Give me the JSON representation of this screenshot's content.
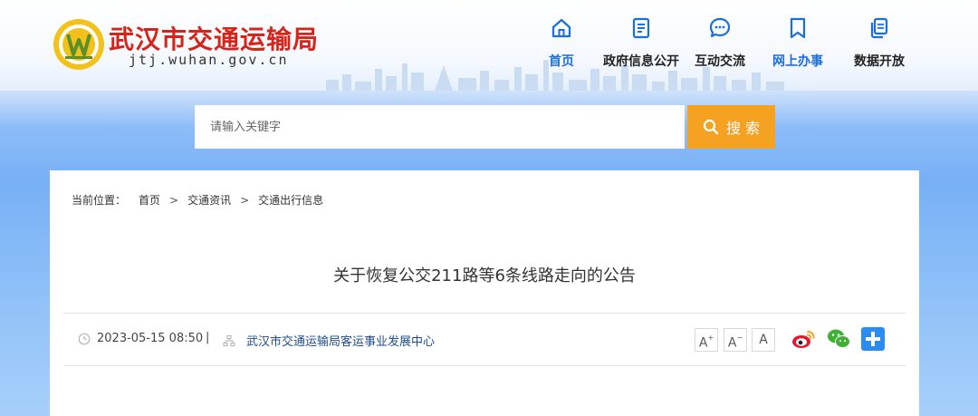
{
  "header": {
    "site_title": "武汉市交通运输局",
    "site_domain": "jtj.wuhan.gov.cn"
  },
  "nav": {
    "items": [
      {
        "label": "首页",
        "icon": "home-icon"
      },
      {
        "label": "政府信息公开",
        "icon": "document-icon"
      },
      {
        "label": "互动交流",
        "icon": "chat-icon"
      },
      {
        "label": "网上办事",
        "icon": "bookmark-icon"
      },
      {
        "label": "数据开放",
        "icon": "copy-icon"
      }
    ]
  },
  "search": {
    "placeholder": "请输入关键字",
    "button_label": "搜 索"
  },
  "breadcrumb": {
    "prefix": "当前位置：",
    "items": [
      "首页",
      "交通资讯",
      "交通出行信息"
    ],
    "separator": ">"
  },
  "article": {
    "title": "关于恢复公交211路等6条线路走向的公告",
    "date": "2023-05-15 08:50",
    "divider": "|",
    "source": "武汉市交通运输局客运事业发展中心"
  },
  "font_controls": {
    "increase": "A",
    "default": "A",
    "decrease": "A"
  },
  "share": [
    "weibo-icon",
    "wechat-icon",
    "more-share-icon"
  ],
  "colors": {
    "title_red": "#d8231a",
    "nav_active": "#1a6fdc",
    "search_button": "#f5a223",
    "source_link": "#1f4c8f"
  }
}
